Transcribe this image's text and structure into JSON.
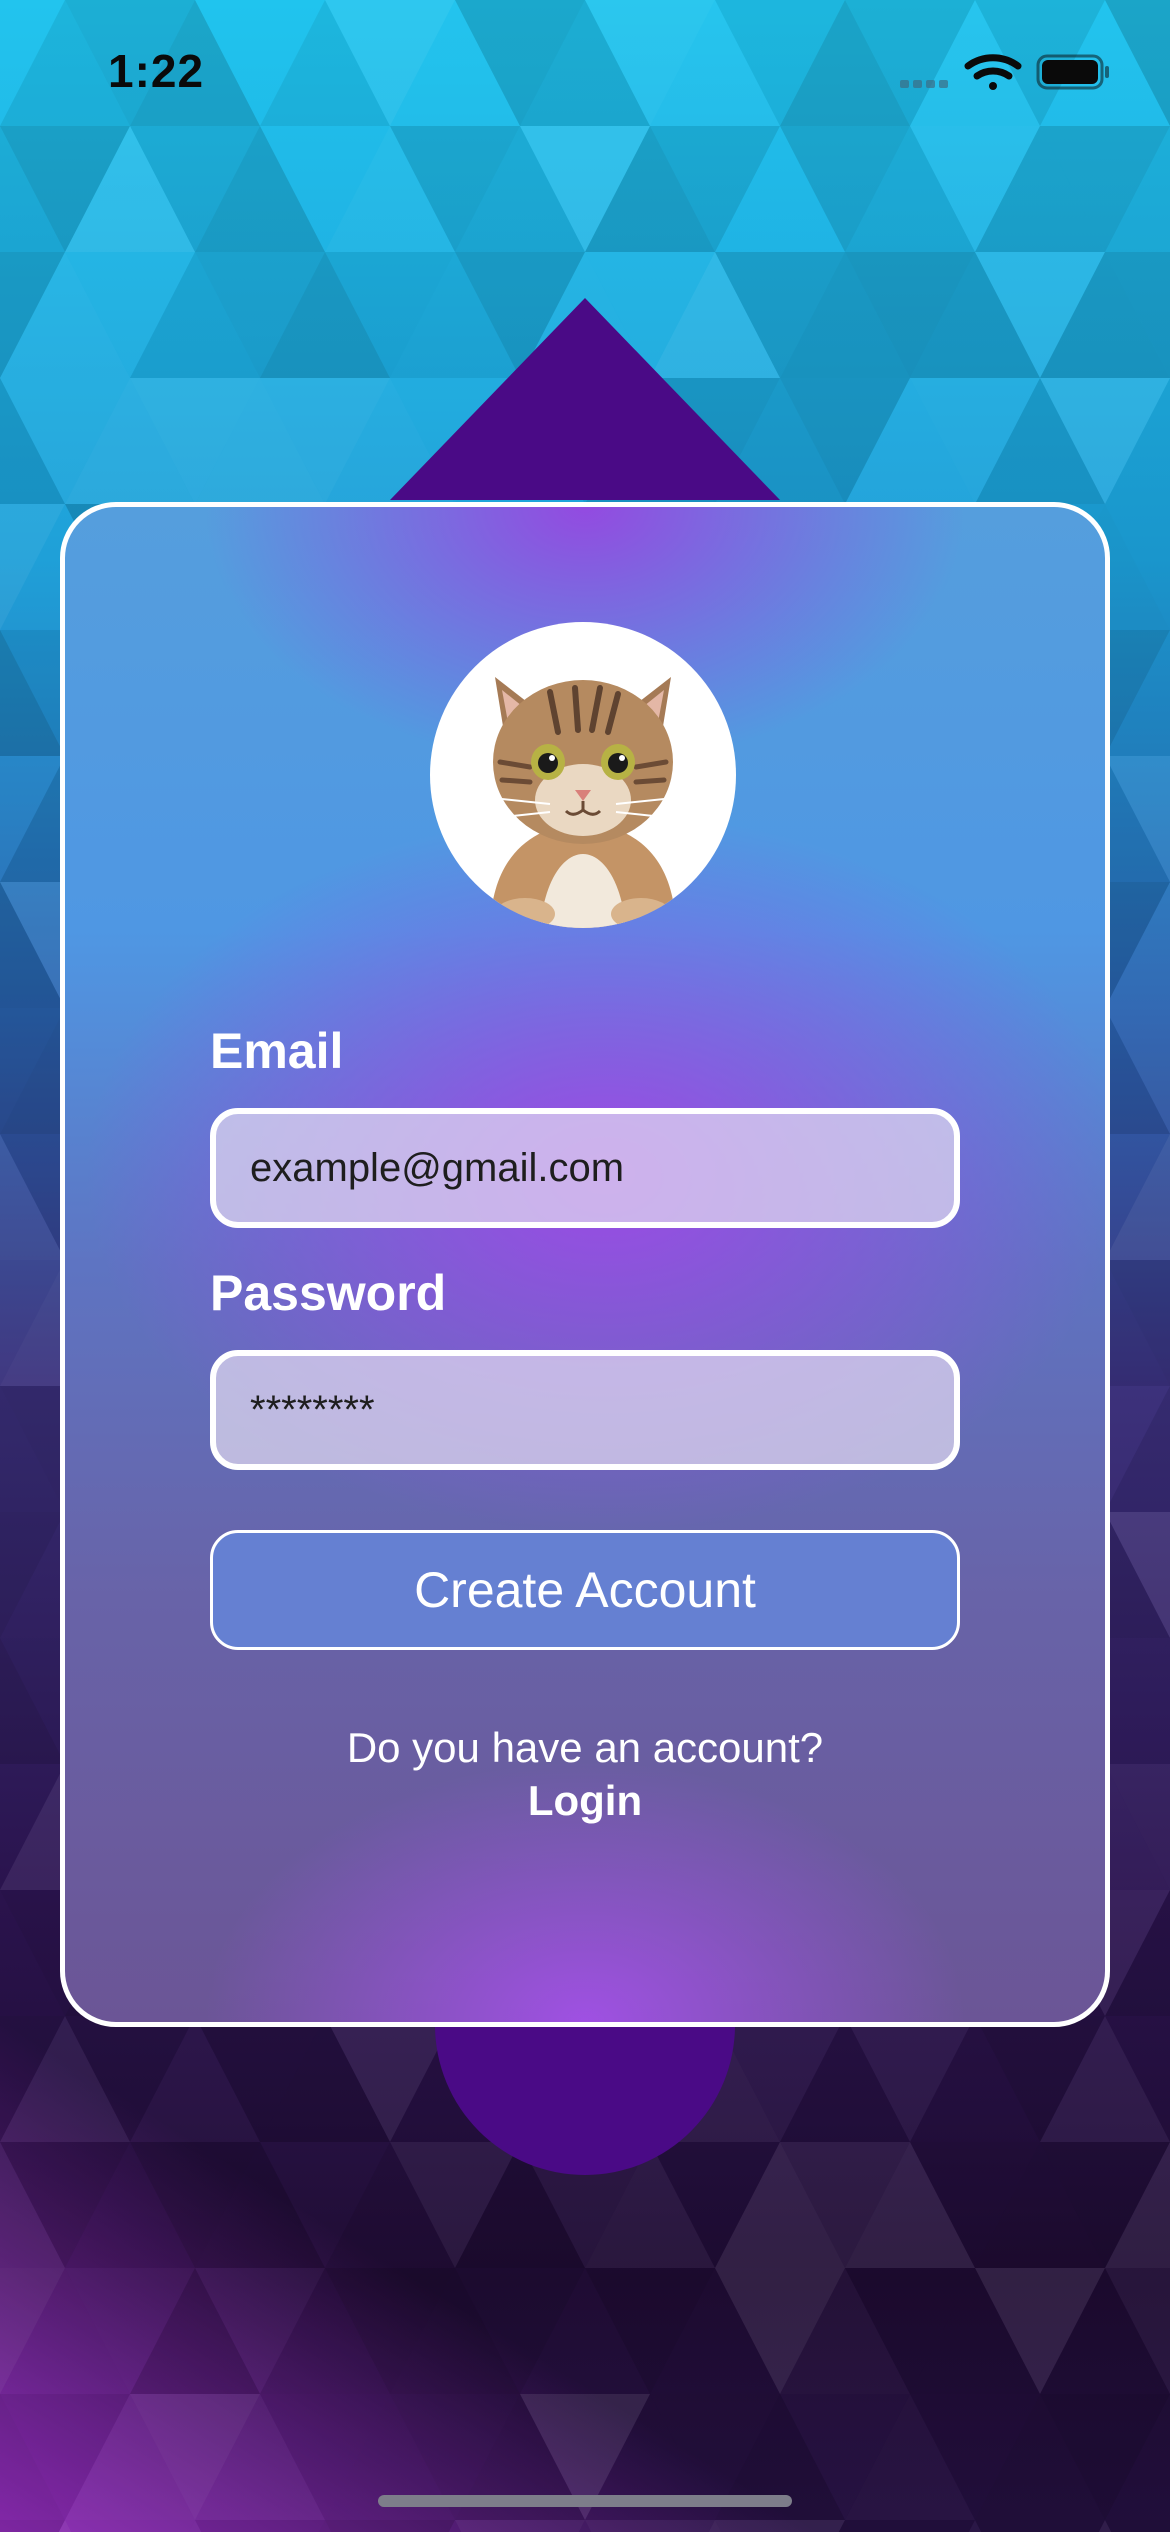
{
  "status_bar": {
    "time": "1:22",
    "icons": [
      "signal-icon",
      "wifi-icon",
      "battery-icon"
    ]
  },
  "avatar": {
    "icon": "cat-photo-icon"
  },
  "form": {
    "email_label": "Email",
    "email_value": "example@gmail.com",
    "password_label": "Password",
    "password_value": "********",
    "create_button_label": "Create Account"
  },
  "footer": {
    "question": "Do you have an account?",
    "login_label": "Login"
  },
  "colors": {
    "bg_top": "#1fc6ef",
    "bg_bottom": "#2a0b3e",
    "accent_purple": "#4a0a86",
    "button_fill": "#6580d2",
    "card_border": "#ffffff"
  }
}
